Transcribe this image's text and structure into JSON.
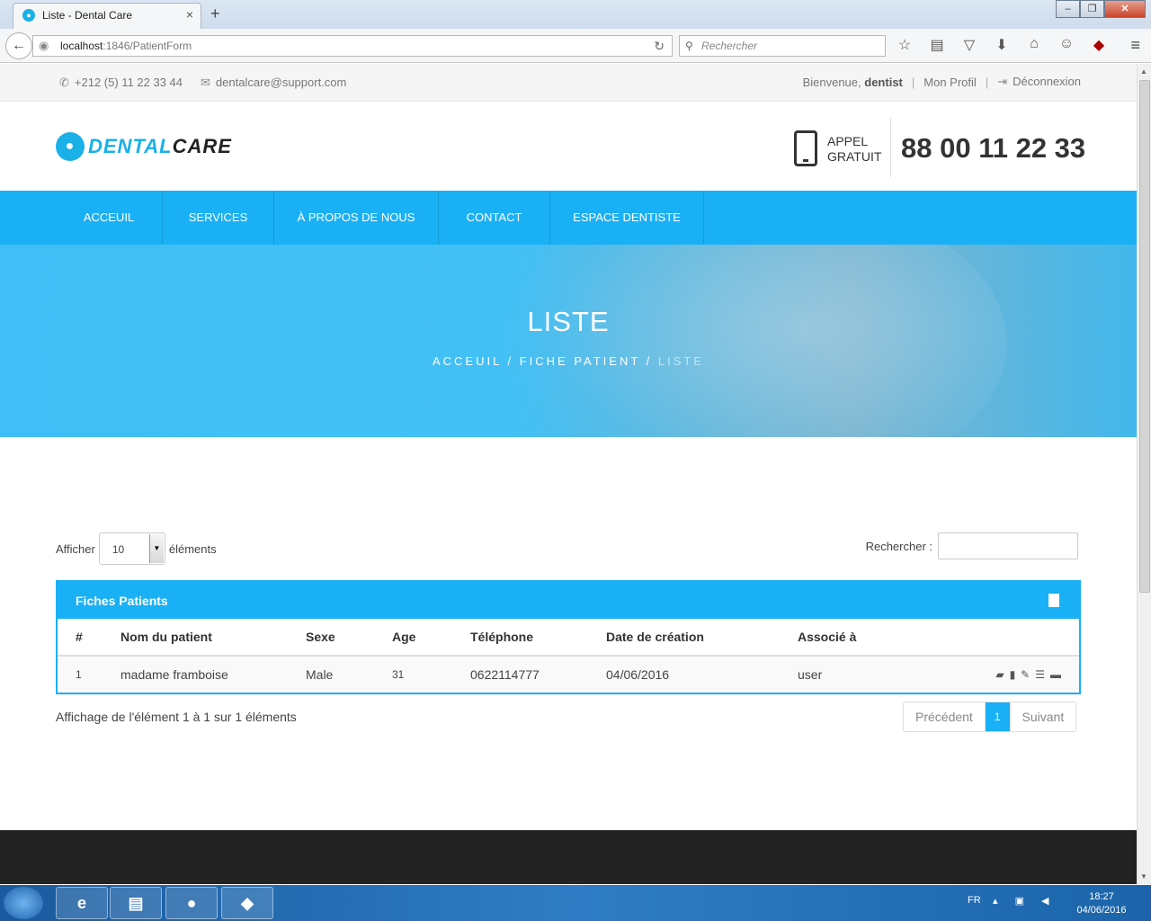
{
  "browser": {
    "tab_title": "Liste - Dental Care",
    "url_host": "localhost",
    "url_rest": ":1846/PatientForm",
    "search_placeholder": "Rechercher"
  },
  "topbar": {
    "phone": "+212 (5) 11 22 33 44",
    "email": "dentalcare@support.com",
    "welcome": "Bienvenue,",
    "user": "dentist",
    "profile": "Mon Profil",
    "logout": "Déconnexion"
  },
  "header": {
    "logo_a": "DENTAL",
    "logo_b": "CARE",
    "appel": "APPEL",
    "gratuit": "GRATUIT",
    "number": "88 00 11 22 33"
  },
  "menu": [
    "ACCEUIL",
    "SERVICES",
    "À PROPOS DE NOUS",
    "CONTACT",
    "ESPACE DENTISTE"
  ],
  "hero": {
    "title": "LISTE",
    "crumb1": "ACCEUIL",
    "crumb2": "FICHE PATIENT",
    "crumb3": "LISTE",
    "sep": "/"
  },
  "controls": {
    "show_label": "Afficher",
    "page_size": "10",
    "elements_label": "éléments",
    "search_label": "Rechercher :"
  },
  "table": {
    "title": "Fiches Patients",
    "headers": [
      "#",
      "Nom du patient",
      "Sexe",
      "Age",
      "Téléphone",
      "Date de création",
      "Associé à"
    ],
    "rows": [
      [
        "1",
        "madame framboise",
        "Male",
        "31",
        "0622114777",
        "04/06/2016",
        "user"
      ]
    ]
  },
  "info": "Affichage de l'élément 1 à 1 sur 1 éléments",
  "pager": {
    "prev": "Précédent",
    "page": "1",
    "next": "Suivant"
  },
  "taskbar": {
    "lang": "FR",
    "time": "18:27",
    "date": "04/06/2016"
  },
  "colors": {
    "accent": "#1ab0f5",
    "footer": "#232323"
  }
}
